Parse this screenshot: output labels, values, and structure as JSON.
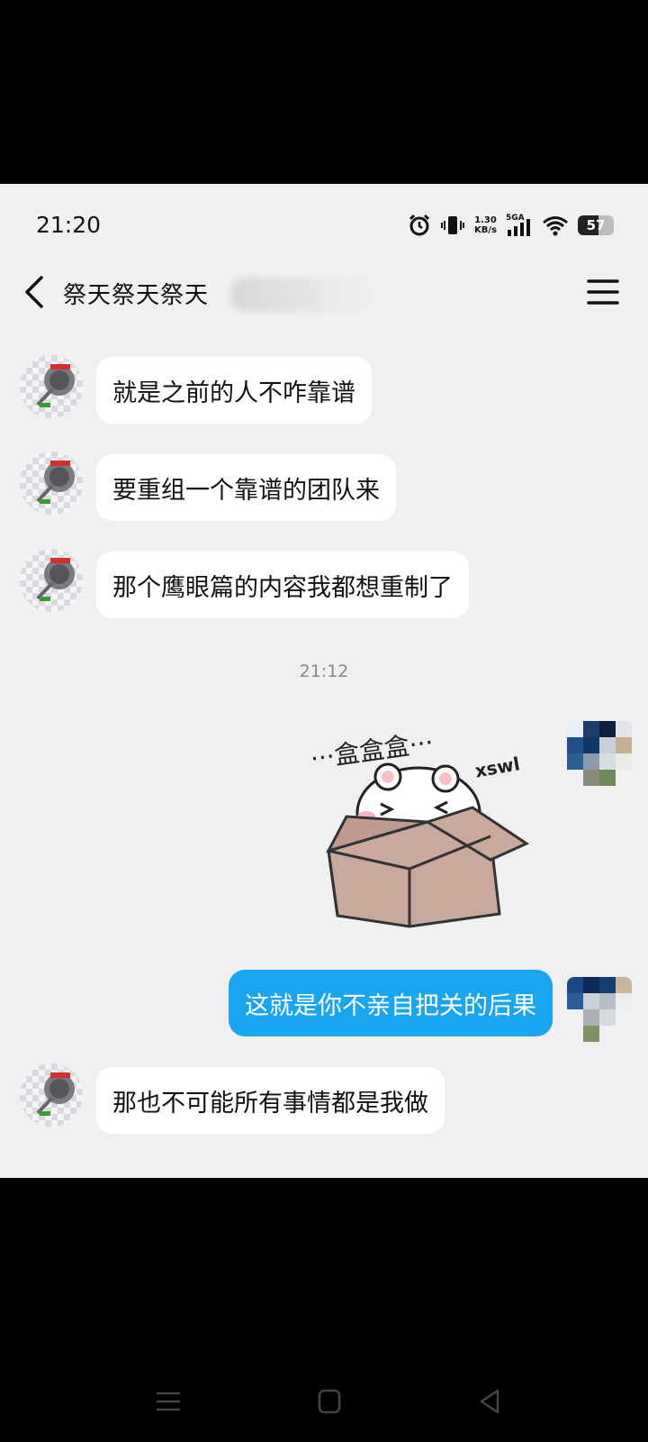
{
  "status_bar": {
    "time": "21:20",
    "net_speed_value": "1.30",
    "net_speed_unit": "KB/s",
    "network": "5GA",
    "battery": "57",
    "battery_level": 0.57
  },
  "header": {
    "title": "祭天祭天祭天",
    "back_icon": "chevron-left-icon",
    "menu_icon": "hamburger-menu-icon"
  },
  "messages": [
    {
      "side": "left",
      "text": "就是之前的人不咋靠谱"
    },
    {
      "side": "left",
      "text": "要重组一个靠谱的团队来"
    },
    {
      "side": "left",
      "text": "那个鹰眼篇的内容我都想重制了"
    },
    {
      "side": "timestamp",
      "text": "21:12"
    },
    {
      "side": "right",
      "type": "sticker",
      "caption": "···盒盒盒···",
      "tag": "xswl"
    },
    {
      "side": "right",
      "text": "这就是你不亲自把关的后果"
    },
    {
      "side": "left",
      "text": "那也不可能所有事情都是我做"
    }
  ],
  "colors": {
    "accent_bubble": "#1aa5f0",
    "background": "#f0f0f2",
    "left_bubble": "#ffffff"
  },
  "nav_bar": {
    "icons": [
      "recent-apps-icon",
      "home-icon",
      "back-triangle-icon"
    ]
  }
}
